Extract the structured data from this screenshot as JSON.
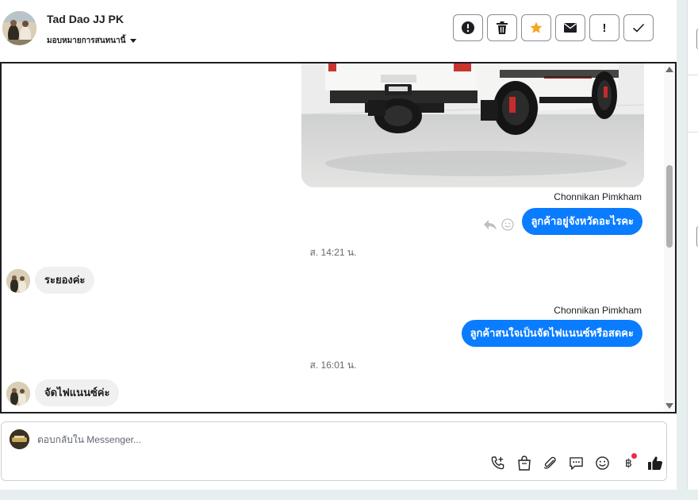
{
  "header": {
    "contact_name": "Tad Dao JJ PK",
    "assign_label": "มอบหมายการสนทนานี้"
  },
  "actions": [
    {
      "name": "alert-icon",
      "label": "!"
    },
    {
      "name": "trash-icon"
    },
    {
      "name": "star-icon",
      "color": "#f5a623"
    },
    {
      "name": "mail-icon"
    },
    {
      "name": "important-icon",
      "label": "!"
    },
    {
      "name": "check-icon"
    }
  ],
  "thread": {
    "messages": [
      {
        "direction": "outgoing",
        "sender": "Chonnikan Pimkham",
        "text": "ลูกค้าอยู่จังหวัดอะไรคะ"
      },
      {
        "type": "timestamp",
        "text": "ส. 14:21 น."
      },
      {
        "direction": "incoming",
        "text": "ระยองค่ะ"
      },
      {
        "direction": "outgoing",
        "sender": "Chonnikan Pimkham",
        "text": "ลูกค้าสนใจเป็นจัดไฟแนนซ์หรือสดคะ"
      },
      {
        "type": "timestamp",
        "text": "ส. 16:01 น."
      },
      {
        "direction": "incoming",
        "text": "จัดไฟแนนซ์ค่ะ"
      }
    ]
  },
  "composer": {
    "placeholder": "ตอบกลับใน Messenger..."
  },
  "colors": {
    "outgoing_bubble": "#0a7cff",
    "incoming_bubble": "#f0f0f0",
    "notification_dot": "#f02849"
  }
}
